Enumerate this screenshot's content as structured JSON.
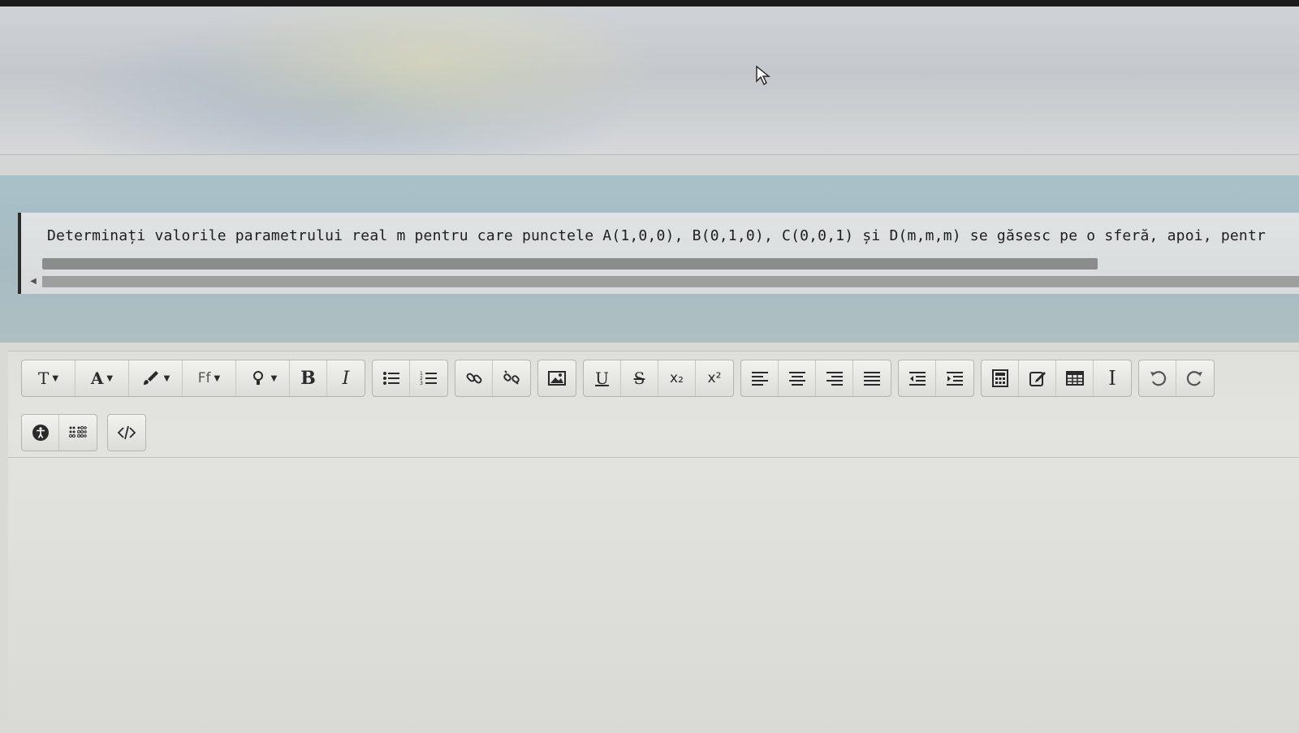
{
  "question": {
    "text": "Determinați valorile parametrului real m pentru care punctele A(1,0,0), B(0,1,0), C(0,0,1) și D(m,m,m) se găsesc pe o sferă, apoi, pentr"
  },
  "toolbar": {
    "row1": [
      {
        "id": "text-style",
        "label": "T",
        "icon": "text-style-icon",
        "wide": true
      },
      {
        "id": "font-color",
        "label": "A",
        "icon": "font-color-icon",
        "wide": true
      },
      {
        "id": "highlight",
        "label": "",
        "icon": "brush-icon",
        "wide": true
      },
      {
        "id": "font-family",
        "label": "Ff",
        "icon": "font-family-icon",
        "wide": true
      },
      {
        "id": "insert",
        "label": "",
        "icon": "lightbulb-icon",
        "wide": true
      },
      {
        "id": "bold",
        "label": "B",
        "icon": "bold-icon"
      },
      {
        "id": "italic",
        "label": "I",
        "icon": "italic-icon"
      },
      {
        "id": "unordered-list",
        "label": "",
        "icon": "bullet-list-icon"
      },
      {
        "id": "ordered-list",
        "label": "",
        "icon": "numbered-list-icon"
      },
      {
        "id": "link",
        "label": "",
        "icon": "link-icon"
      },
      {
        "id": "unlink",
        "label": "",
        "icon": "unlink-icon"
      },
      {
        "id": "image",
        "label": "",
        "icon": "image-icon"
      },
      {
        "id": "underline",
        "label": "U",
        "icon": "underline-icon"
      },
      {
        "id": "strikethrough",
        "label": "S",
        "icon": "strikethrough-icon"
      },
      {
        "id": "subscript",
        "label": "x₂",
        "icon": "subscript-icon"
      },
      {
        "id": "superscript",
        "label": "x²",
        "icon": "superscript-icon"
      },
      {
        "id": "align-left",
        "label": "",
        "icon": "align-left-icon"
      },
      {
        "id": "align-center",
        "label": "",
        "icon": "align-center-icon"
      },
      {
        "id": "align-right",
        "label": "",
        "icon": "align-right-icon"
      },
      {
        "id": "align-justify",
        "label": "",
        "icon": "align-justify-icon"
      },
      {
        "id": "outdent",
        "label": "",
        "icon": "outdent-icon"
      },
      {
        "id": "indent",
        "label": "",
        "icon": "indent-icon"
      },
      {
        "id": "equation",
        "label": "",
        "icon": "calculator-icon"
      },
      {
        "id": "edit",
        "label": "",
        "icon": "edit-icon"
      },
      {
        "id": "table",
        "label": "",
        "icon": "table-icon"
      },
      {
        "id": "cursor-tool",
        "label": "I",
        "icon": "text-cursor-icon"
      },
      {
        "id": "undo",
        "label": "",
        "icon": "undo-icon"
      },
      {
        "id": "redo",
        "label": "",
        "icon": "redo-icon"
      }
    ],
    "row2": [
      {
        "id": "accessibility",
        "icon": "accessibility-icon"
      },
      {
        "id": "braille",
        "icon": "braille-icon"
      },
      {
        "id": "html-source",
        "icon": "code-icon"
      }
    ]
  }
}
